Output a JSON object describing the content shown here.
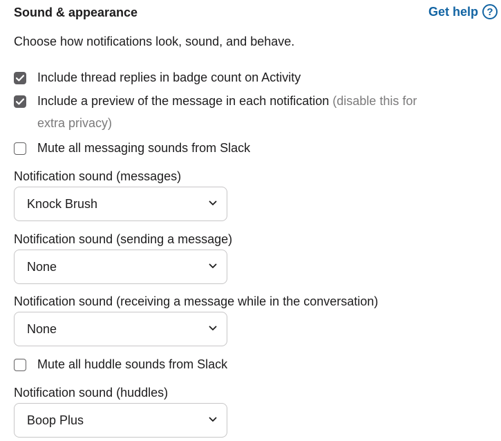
{
  "section": {
    "title": "Sound & appearance",
    "help_label": "Get help",
    "help_icon": "question-circle-icon",
    "accent_color": "#1264a3",
    "description": "Choose how notifications look, sound, and behave."
  },
  "options": {
    "badge_count": {
      "label": "Include thread replies in badge count on Activity",
      "checked": true
    },
    "preview": {
      "label": "Include a preview of the message in each notification",
      "hint_line1": "(disable this for",
      "hint_line2": "extra privacy)",
      "checked": true
    },
    "mute_messaging": {
      "label": "Mute all messaging sounds from Slack",
      "checked": false
    },
    "mute_huddle": {
      "label": "Mute all huddle sounds from Slack",
      "checked": false
    }
  },
  "sounds": {
    "messages": {
      "label": "Notification sound (messages)",
      "value": "Knock Brush"
    },
    "sending": {
      "label": "Notification sound (sending a message)",
      "value": "None"
    },
    "receiving": {
      "label": "Notification sound (receiving a message while in the conversation)",
      "value": "None"
    },
    "huddles": {
      "label": "Notification sound (huddles)",
      "value": "Boop Plus"
    }
  }
}
